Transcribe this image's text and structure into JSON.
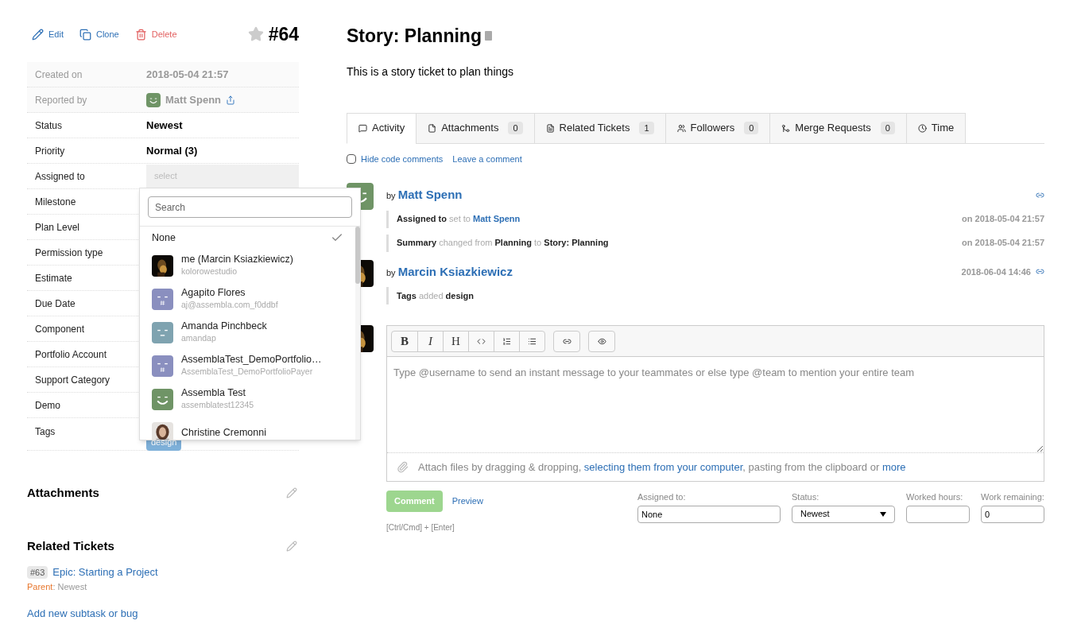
{
  "actions": [
    {
      "kind": "edit",
      "label": "Edit"
    },
    {
      "kind": "clone",
      "label": "Clone"
    },
    {
      "kind": "delete",
      "label": "Delete"
    }
  ],
  "starred": false,
  "ticket_number": "#64",
  "fields": [
    {
      "label": "Created on",
      "kind": "readonly",
      "value": "2018-05-04 21:57"
    },
    {
      "label": "Reported by",
      "kind": "user",
      "value": "Matt Spenn"
    },
    {
      "label": "Status",
      "kind": "bold",
      "value": "Newest"
    },
    {
      "label": "Priority",
      "kind": "bold",
      "value": "Normal (3)"
    },
    {
      "label": "Assigned to",
      "kind": "select",
      "value": "select"
    },
    {
      "label": "Milestone",
      "kind": "hidden"
    },
    {
      "label": "Plan Level",
      "kind": "hidden"
    },
    {
      "label": "Permission type",
      "kind": "hidden"
    },
    {
      "label": "Estimate",
      "kind": "hidden"
    },
    {
      "label": "Due Date",
      "kind": "hidden"
    },
    {
      "label": "Component",
      "kind": "hidden"
    },
    {
      "label": "Portfolio Account",
      "kind": "hidden"
    },
    {
      "label": "Support Category",
      "kind": "hidden"
    },
    {
      "label": "Demo",
      "kind": "hidden"
    },
    {
      "label": "Tags",
      "kind": "tags",
      "value": "design"
    }
  ],
  "dropdown": {
    "placeholder": "Search",
    "options": [
      {
        "name": "None",
        "selected": true
      },
      {
        "name": "me (Marcin Ksiazkiewicz)",
        "sub": "kolorowestudio",
        "selected": false
      },
      {
        "name": "Agapito Flores",
        "sub": "aj@assembla.com_f0ddbf",
        "kind": "hash",
        "color": "#8a8fbf",
        "selected": false
      },
      {
        "name": "Amanda Pinchbeck",
        "sub": "amandap",
        "kind": "face",
        "color": "#7fa3b0",
        "selected": false
      },
      {
        "name": "AssemblaTest_DemoPortfolio…",
        "sub": "AssemblaTest_DemoPortfolioPayer",
        "kind": "hash",
        "color": "#8a8fbf",
        "selected": false
      },
      {
        "name": "Assembla Test",
        "sub": "assemblatest12345",
        "kind": "smile",
        "color": "#6f9466",
        "selected": false
      },
      {
        "name": "Christine Cremonni",
        "kind": "portrait",
        "selected": false
      }
    ]
  },
  "attachments": {
    "title": "Attachments"
  },
  "related": {
    "title": "Related Tickets",
    "tickets": [
      {
        "number": "#63",
        "title": "Epic: Starting a Project",
        "relation": "Parent",
        "status": ": Newest"
      }
    ],
    "add_link": "Add new subtask or bug"
  },
  "title": "Story: Planning",
  "description": "This is a story ticket to plan things",
  "tabs": [
    {
      "label": "Activity",
      "selected": true
    },
    {
      "label": "Attachments",
      "count": "0",
      "selected": false
    },
    {
      "label": "Related Tickets",
      "count": "1",
      "selected": false
    },
    {
      "label": "Followers",
      "count": "0",
      "selected": false
    },
    {
      "label": "Merge Requests",
      "count": "0",
      "selected": false
    },
    {
      "label": "Time",
      "selected": false
    }
  ],
  "hide_code_comments": {
    "label": "Hide code comments",
    "checked": false
  },
  "leave_comment": "Leave a comment",
  "activity": [
    {
      "by": "by",
      "author": "Matt Spenn",
      "kind": "smile",
      "color": "#6f9466",
      "changes": [
        {
          "time": "on 2018-05-04 21:57",
          "segments": [
            {
              "kind": "field",
              "text": "Assigned to"
            },
            {
              "kind": "verb",
              "text": "set to"
            },
            {
              "kind": "link",
              "text": "Matt Spenn"
            }
          ]
        },
        {
          "time": "on 2018-05-04 21:57",
          "segments": [
            {
              "kind": "field",
              "text": "Summary"
            },
            {
              "kind": "verb",
              "text": "changed from"
            },
            {
              "kind": "field",
              "text": "Planning"
            },
            {
              "kind": "verb",
              "text": "to"
            },
            {
              "kind": "field",
              "text": "Story: Planning"
            }
          ]
        }
      ]
    },
    {
      "by": "by",
      "author": "Marcin Ksiazkiewicz",
      "time": "2018-06-04 14:46",
      "changes": [
        {
          "segments": [
            {
              "kind": "field",
              "text": "Tags"
            },
            {
              "kind": "verb",
              "text": "added"
            },
            {
              "kind": "field",
              "text": "design"
            }
          ]
        }
      ]
    }
  ],
  "editor": {
    "toolbar": [
      [
        {
          "kind": "bold",
          "label": "B"
        },
        {
          "kind": "italic",
          "label": "I"
        },
        {
          "kind": "heading",
          "label": "H"
        },
        {
          "kind": "code"
        },
        {
          "kind": "ol"
        },
        {
          "kind": "ul"
        }
      ],
      [
        {
          "kind": "link"
        }
      ],
      [
        {
          "kind": "preview"
        }
      ]
    ],
    "placeholder": "Type @username to send an instant message to your teammates or else type @team to mention your entire team",
    "attach": [
      {
        "kind": "text",
        "text": "Attach files by dragging & dropping, "
      },
      {
        "kind": "link",
        "text": "selecting them from your computer"
      },
      {
        "kind": "text",
        "text": ", pasting from the clipboard or "
      },
      {
        "kind": "link",
        "text": "more"
      }
    ]
  },
  "comment_button": "Comment",
  "preview": "Preview",
  "shortcut": "[Ctrl/Cmd] + [Enter]",
  "form": [
    {
      "kind": "input",
      "label": "Assigned to:",
      "value": "None"
    },
    {
      "kind": "select",
      "label": "Status:",
      "value": "Newest"
    },
    {
      "kind": "input",
      "label": "Worked hours:"
    },
    {
      "kind": "input",
      "label": "Work remaining:",
      "value": "0"
    }
  ]
}
